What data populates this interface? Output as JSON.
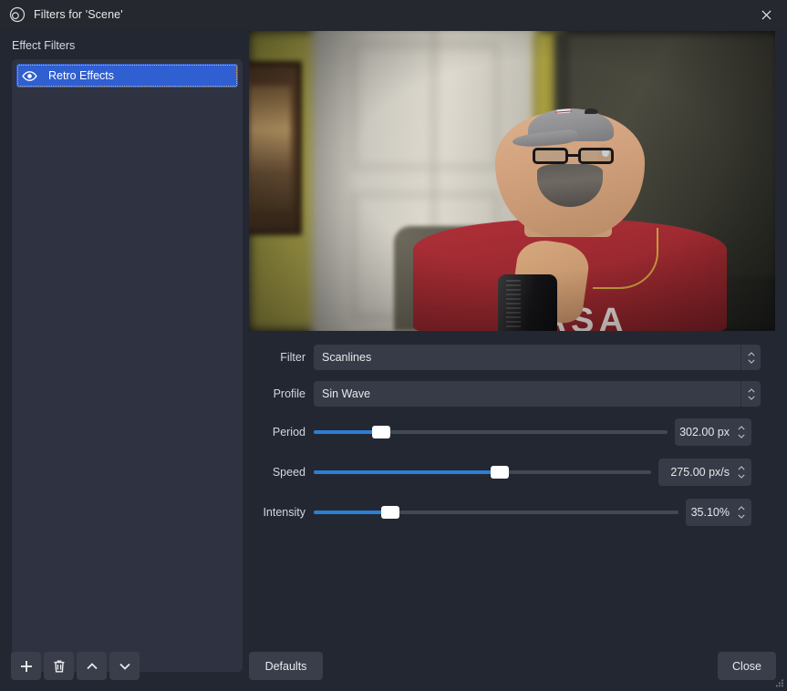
{
  "window": {
    "title": "Filters for 'Scene'",
    "logo_icon": "obs-logo-icon",
    "close_icon": "close-icon"
  },
  "sidebar": {
    "section_label": "Effect Filters",
    "items": [
      {
        "label": "Retro Effects",
        "icon": "eye-icon",
        "selected": true
      }
    ],
    "toolbar": [
      {
        "name": "add-filter-button",
        "icon": "plus-icon"
      },
      {
        "name": "remove-filter-button",
        "icon": "trash-icon"
      },
      {
        "name": "move-filter-up-button",
        "icon": "chevron-up-icon"
      },
      {
        "name": "move-filter-down-button",
        "icon": "chevron-down-icon"
      }
    ]
  },
  "preview": {
    "shirt_text": "NASA"
  },
  "properties": {
    "combos": [
      {
        "label": "Filter",
        "value": "Scanlines"
      },
      {
        "label": "Profile",
        "value": "Sin Wave"
      }
    ],
    "sliders": [
      {
        "label": "Period",
        "value": "302.00 px",
        "percent": 19,
        "track_width": 388,
        "spin_width": 84
      },
      {
        "label": "Speed",
        "value": "275.00 px/s",
        "percent": 55,
        "track_width": 370,
        "spin_width": 102
      },
      {
        "label": "Intensity",
        "value": "35.10%",
        "percent": 21,
        "track_width": 400,
        "spin_width": 72
      }
    ]
  },
  "footer": {
    "defaults_label": "Defaults",
    "close_label": "Close",
    "resize_grip_icon": "resize-grip-icon"
  },
  "colors": {
    "accent_blue": "#2b7fd4",
    "selection_blue": "#2f5fd0",
    "dialog_bg": "#232732",
    "panel_bg": "#2f3240",
    "field_bg": "#373b47",
    "focus_outline": "#d8b477"
  }
}
